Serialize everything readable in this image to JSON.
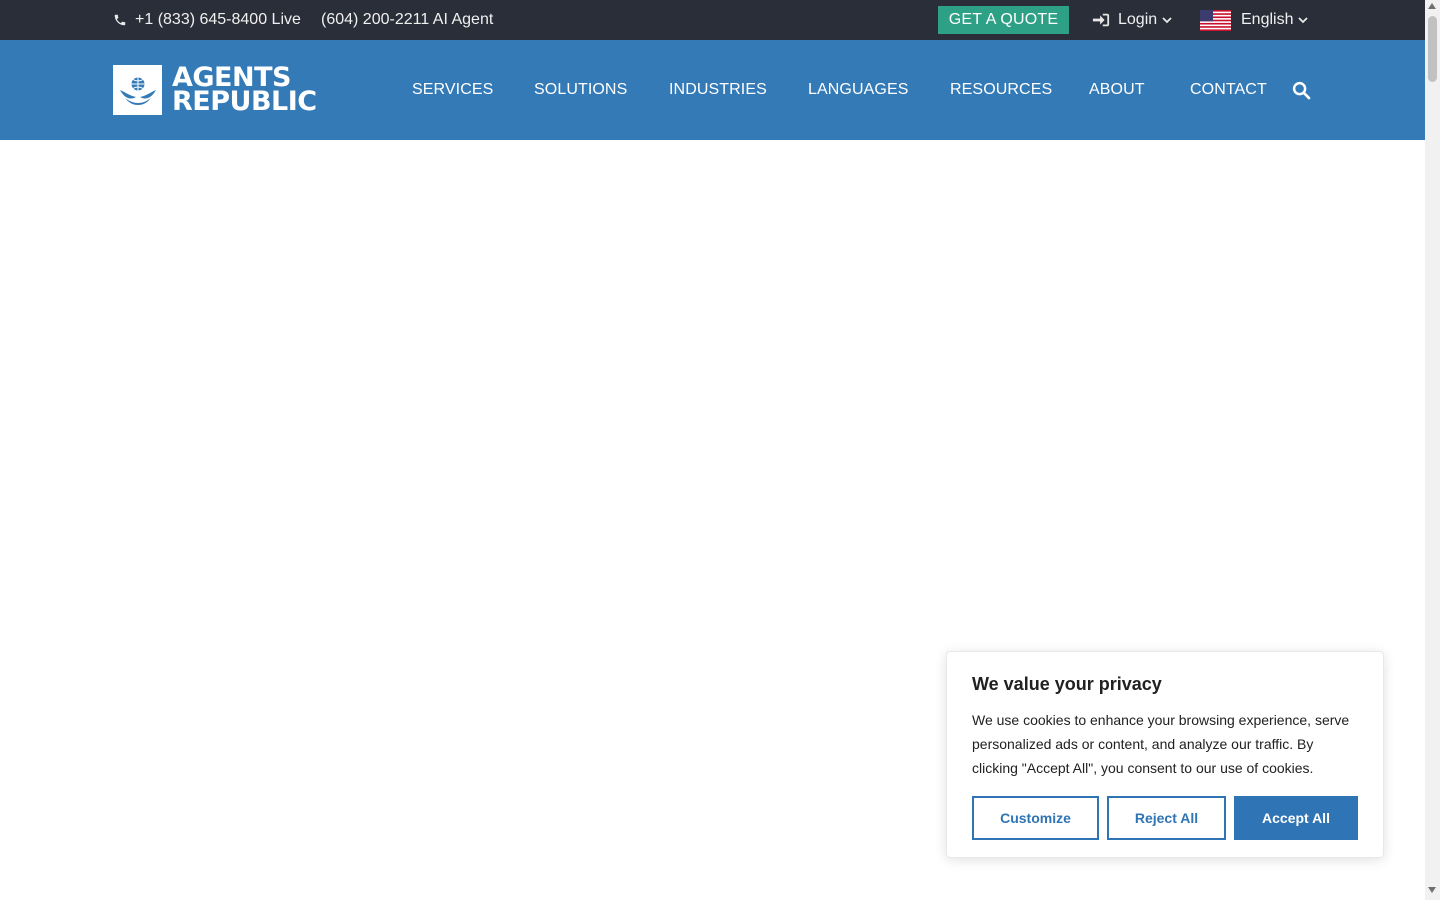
{
  "topbar": {
    "phone_live": "+1 (833) 645-8400 Live",
    "phone_ai": "(604) 200-2211 AI Agent",
    "quote_label": "GET A QUOTE",
    "login_label": "Login",
    "language_label": "English"
  },
  "header": {
    "logo_line1": "AGENTS",
    "logo_line2": "REPUBLIC",
    "nav": [
      {
        "label": "SERVICES"
      },
      {
        "label": "SOLUTIONS"
      },
      {
        "label": "INDUSTRIES"
      },
      {
        "label": "LANGUAGES"
      },
      {
        "label": "RESOURCES"
      },
      {
        "label": "ABOUT"
      },
      {
        "label": "CONTACT"
      }
    ]
  },
  "cookie_banner": {
    "title": "We value your privacy",
    "body": "We use cookies to enhance your browsing experience, serve personalized ads or content, and analyze our traffic. By clicking \"Accept All\", you consent to our use of cookies.",
    "customize_label": "Customize",
    "reject_label": "Reject All",
    "accept_label": "Accept All"
  },
  "icons": {
    "phone": "phone-icon",
    "login": "login-icon",
    "flag": "us-flag-icon",
    "search": "search-icon"
  },
  "colors": {
    "topbar_bg": "#2a2e38",
    "header_bg": "#337ab7",
    "quote_button": "#2ea086",
    "cookie_accent": "#2f74b5"
  }
}
